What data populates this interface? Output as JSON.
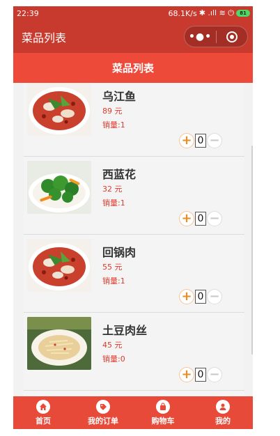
{
  "status_bar": {
    "time": "22:39",
    "net_speed": "68.1K/s",
    "signal_glyphs": "✱ .ıll ≋ ⏻",
    "battery": "81"
  },
  "nav": {
    "title": "菜品列表",
    "more_icon": "more-dots-icon",
    "close_icon": "target-close-icon"
  },
  "header": {
    "title": "菜品列表"
  },
  "dishes": [
    {
      "name": "乌江鱼",
      "price": "89 元",
      "sales": "销量:1",
      "qty": "0",
      "image": "fish-dish"
    },
    {
      "name": "西蓝花",
      "price": "32 元",
      "sales": "销量:1",
      "qty": "0",
      "image": "broccoli-dish"
    },
    {
      "name": "回锅肉",
      "price": "55 元",
      "sales": "销量:1",
      "qty": "0",
      "image": "fish-dish"
    },
    {
      "name": "土豆肉丝",
      "price": "45 元",
      "sales": "销量:0",
      "qty": "0",
      "image": "potato-dish"
    }
  ],
  "stepper": {
    "plus": "+",
    "minus": "−"
  },
  "tabs": [
    {
      "label": "首页",
      "icon": "home-icon"
    },
    {
      "label": "我的订单",
      "icon": "order-tag-icon"
    },
    {
      "label": "购物车",
      "icon": "shopping-bag-icon"
    },
    {
      "label": "我的",
      "icon": "user-icon"
    }
  ],
  "colors": {
    "nav_bg": "#c8392e",
    "header_bg": "#ee4a3a",
    "tab_bg": "#e84a3a",
    "price_red": "#e0392b",
    "plus_orange": "#f08a1e"
  }
}
